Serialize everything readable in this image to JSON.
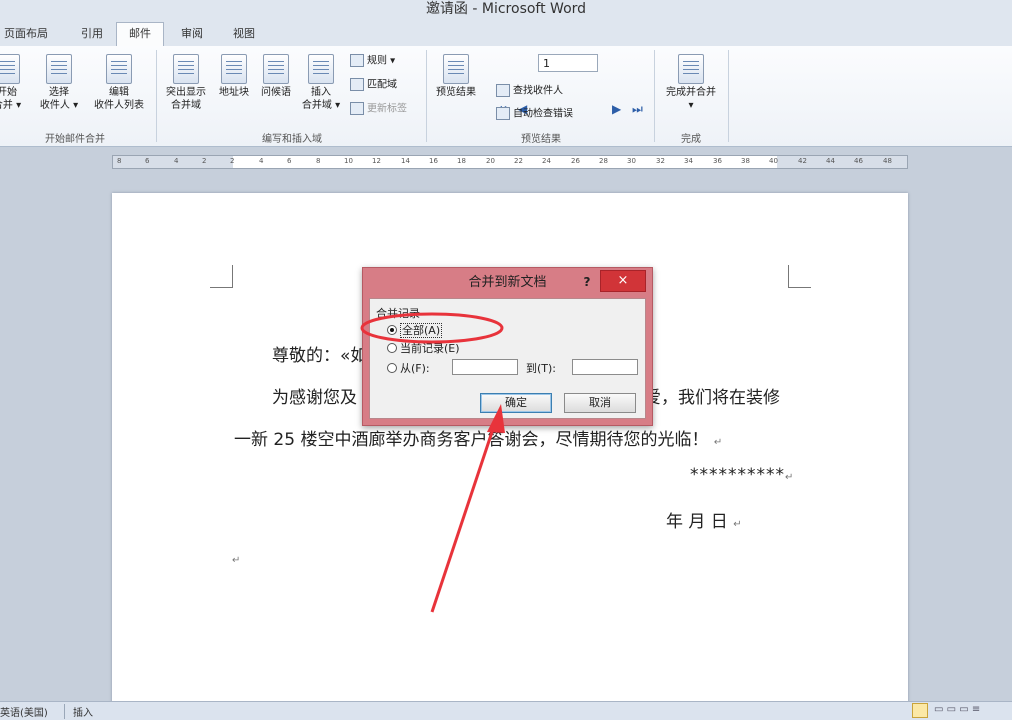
{
  "window": {
    "title": "邀请函 - Microsoft Word"
  },
  "tabs": [
    "页面布局",
    "引用",
    "邮件",
    "审阅",
    "视图"
  ],
  "active_tab": "邮件",
  "ribbon": {
    "group_start": {
      "label": "开始邮件合并",
      "btn_start": [
        "开始",
        "合并 ▾"
      ],
      "btn_select": [
        "选择",
        "收件人 ▾"
      ],
      "btn_edit": [
        "编辑",
        "收件人列表"
      ]
    },
    "group_write": {
      "label": "编写和插入域",
      "btn_highlight": [
        "突出显示",
        "合并域"
      ],
      "btn_address": "地址块",
      "btn_greeting": "问候语",
      "btn_insert": [
        "插入",
        "合并域 ▾"
      ],
      "rules": "规则 ▾",
      "match": "匹配域",
      "update": "更新标签"
    },
    "group_preview": {
      "label": "预览结果",
      "btn_preview": "预览结果",
      "record": "1",
      "find": "查找收件人",
      "autocheck": "自动检查错误"
    },
    "group_finish": {
      "label": "完成",
      "btn_finish": [
        "完成并合并",
        "▾"
      ]
    }
  },
  "ruler": {
    "ticks": [
      "8",
      "6",
      "4",
      "2",
      "2",
      "4",
      "6",
      "8",
      "10",
      "12",
      "14",
      "16",
      "18",
      "20",
      "22",
      "24",
      "26",
      "28",
      "30",
      "32",
      "34",
      "36",
      "38",
      "40",
      "42",
      "44",
      "46",
      "48"
    ]
  },
  "document": {
    "line1": "尊敬的：«如",
    "line2": "为感谢您及",
    "line2b": "爱，我们将在装修",
    "line3": "一新 25 楼空中酒廊举办商务客户答谢会，尽情期待您的光临！",
    "signature": "**********",
    "date": "年   月   日"
  },
  "dialog": {
    "title": "合并到新文档",
    "help": "?",
    "close": "×",
    "section": "合并记录",
    "opt_all": "全部(A)",
    "opt_current": "当前记录(E)",
    "opt_from": "从(F):",
    "to_label": "到(T):",
    "ok": "确定",
    "cancel": "取消"
  },
  "statusbar": {
    "language": "英语(美国)",
    "mode": "插入"
  },
  "colors": {
    "annotation": "#e8333b",
    "dialog_border": "#d77d86",
    "close_button": "#d13438"
  }
}
